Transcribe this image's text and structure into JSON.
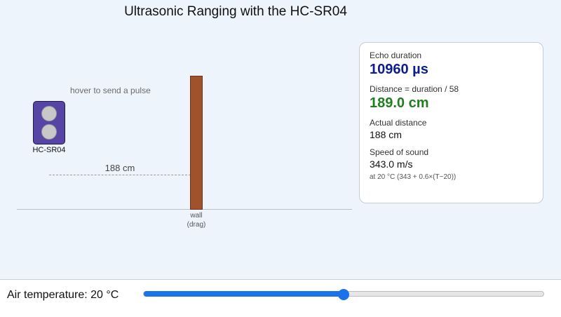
{
  "title": "Ultrasonic Ranging with the HC-SR04",
  "scene": {
    "hint": "hover to send a pulse",
    "sensor_label": "HC-SR04",
    "distance_label": "188 cm",
    "wall_label_line1": "wall",
    "wall_label_line2": "(drag)"
  },
  "panel": {
    "echo_label": "Echo duration",
    "echo_value": "10960 µs",
    "distance_calc_label": "Distance = duration / 58",
    "distance_calc_value": "189.0 cm",
    "actual_label": "Actual distance",
    "actual_value": "188 cm",
    "speed_label": "Speed of sound",
    "speed_value": "343.0 m/s",
    "speed_note": "at 20 °C  (343 + 0.6×(T−20))"
  },
  "controls": {
    "temperature_label": "Air temperature: 20 °C",
    "temperature_slider_fraction": 0.5
  },
  "colors": {
    "accent": "#1a73e8",
    "sensor": "#5645a4",
    "wall": "#a0522d",
    "echo_value": "#0b1d8f",
    "distance_value": "#1f7f1f"
  }
}
